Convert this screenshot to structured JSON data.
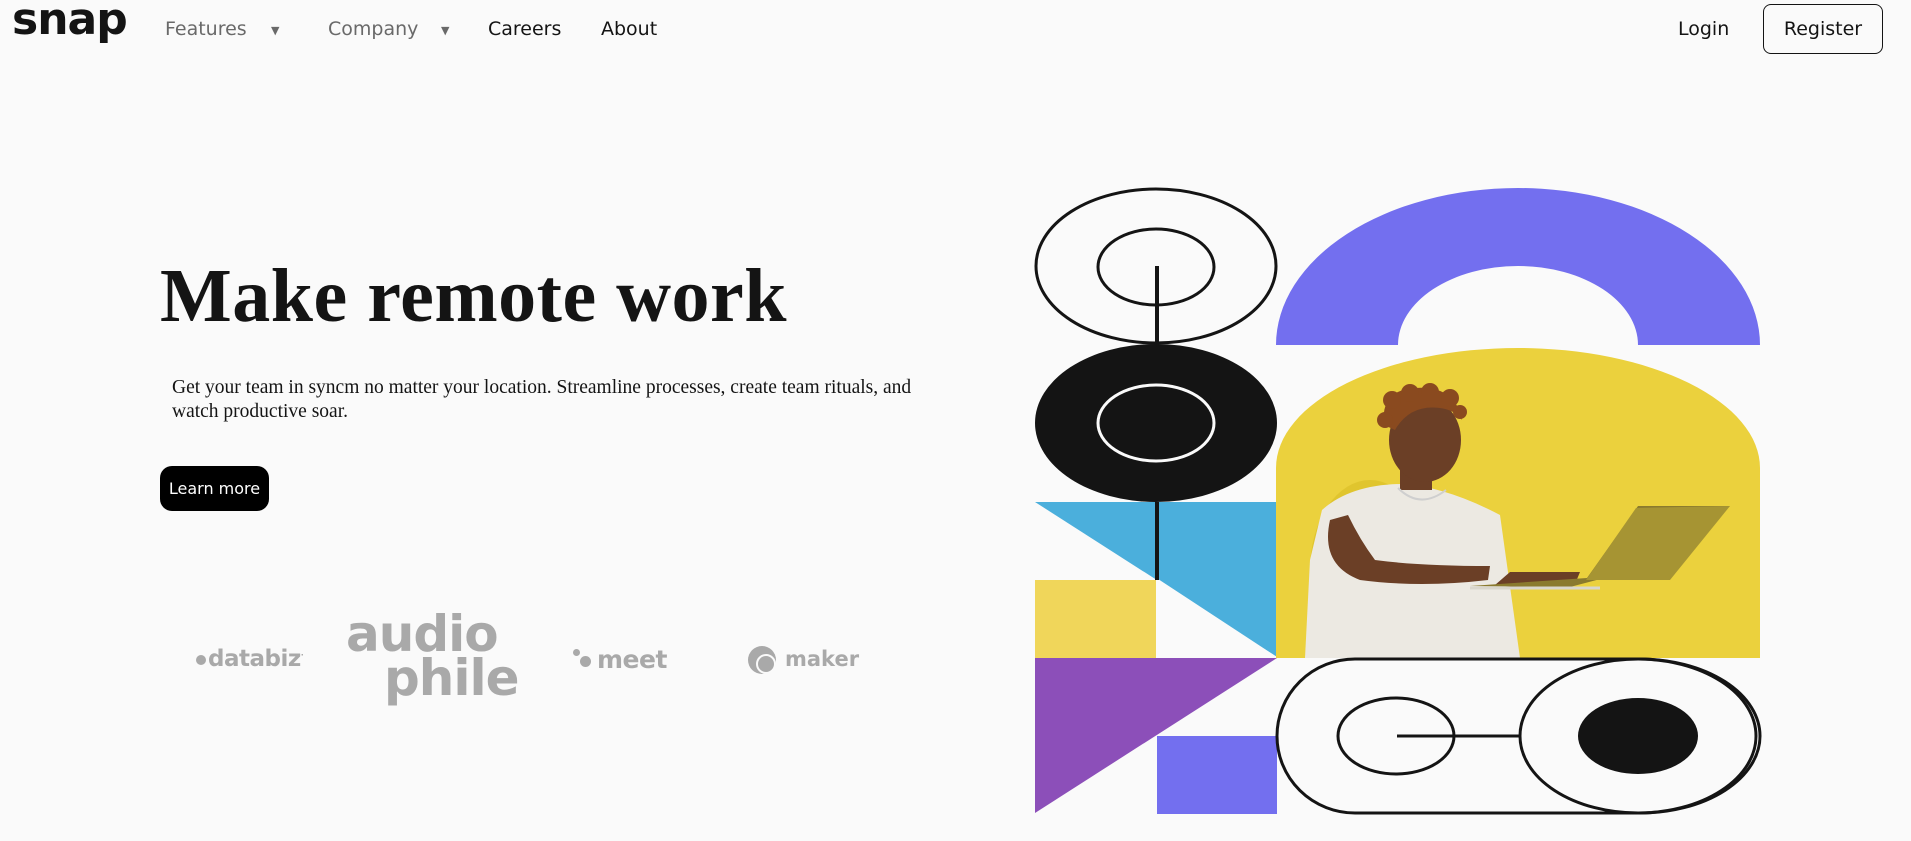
{
  "brand": {
    "logo": "snap"
  },
  "nav": {
    "features": "Features",
    "company": "Company",
    "careers": "Careers",
    "about": "About",
    "caret": "▼",
    "login": "Login",
    "register": "Register"
  },
  "hero": {
    "title": "Make remote work",
    "description": "Get your team in syncm no matter your location. Streamline processes, create team rituals, and watch productive soar.",
    "cta": "Learn more"
  },
  "clients": {
    "databiz": "databiz",
    "audiophile_line1": "audio",
    "audiophile_line2": "phile",
    "meet": "meet",
    "maker": "maker"
  },
  "colors": {
    "background": "#fafafa",
    "text": "#141414",
    "muted": "#696969",
    "logo_gray": "#a9a9a9",
    "purple": "#736fef",
    "yellow": "#ebd13d",
    "blue": "#4bafdc",
    "violet": "#8c4fb9",
    "light_yellow": "#f0d65a"
  }
}
